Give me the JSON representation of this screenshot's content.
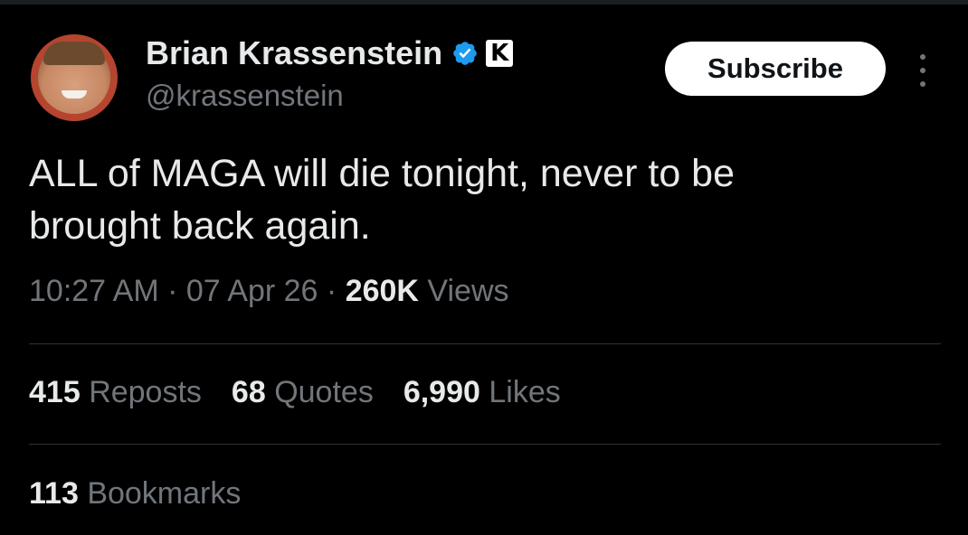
{
  "author": {
    "name": "Brian Krassenstein",
    "handle": "@krassenstein",
    "verified_icon": "verified-badge-icon",
    "affiliate_icon": "affiliate-k-icon",
    "affiliate_letter": "K"
  },
  "actions": {
    "subscribe_label": "Subscribe",
    "more_icon": "more-vertical-icon"
  },
  "tweet": {
    "text_line1": "ALL of MAGA will die tonight, never to be",
    "text_line2": "brought back again.",
    "time": "10:27 AM",
    "date": "07 Apr 26",
    "separator": "·",
    "views_count": "260K",
    "views_label": "Views"
  },
  "stats": {
    "reposts_count": "415",
    "reposts_label": "Reposts",
    "quotes_count": "68",
    "quotes_label": "Quotes",
    "likes_count": "6,990",
    "likes_label": "Likes",
    "bookmarks_count": "113",
    "bookmarks_label": "Bookmarks"
  },
  "colors": {
    "background": "#000000",
    "text_primary": "#e7e9ea",
    "text_secondary": "#71767b",
    "verified_blue": "#1d9bf0",
    "divider": "#2f3336"
  }
}
